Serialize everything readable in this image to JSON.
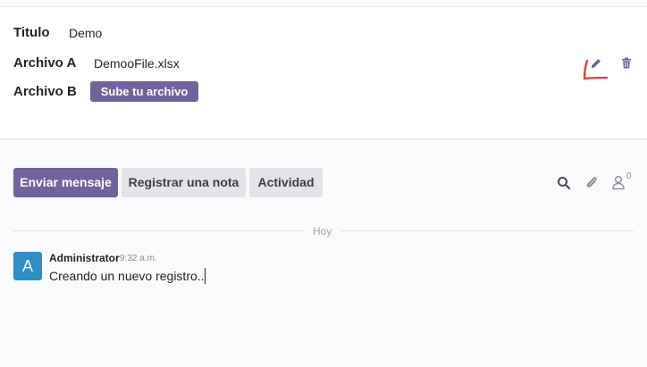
{
  "form": {
    "fields": [
      {
        "label": "Titulo",
        "value": "Demo"
      },
      {
        "label": "Archivo A",
        "value": "DemooFile.xlsx"
      },
      {
        "label": "Archivo B",
        "button_label": "Sube tu archivo"
      }
    ],
    "actions": {
      "edit_icon": "pencil-icon",
      "delete_icon": "trash-icon"
    }
  },
  "chatter": {
    "buttons": [
      "Enviar mensaje",
      "Registrar una nota",
      "Actividad"
    ],
    "toolbar_icons": [
      "search-icon",
      "paperclip-icon",
      "user-icon"
    ],
    "follower_count": "0",
    "day_separator": "Hoy",
    "messages": [
      {
        "avatar_letter": "A",
        "author": "Administrator",
        "time": "9:32 a.m.",
        "body": "Creando un nuevo registro.."
      }
    ]
  },
  "colors": {
    "primary": "#71639e",
    "secondary_button": "#e2e4e8",
    "avatar": "#2d8fc4",
    "annotation": "#e53935"
  }
}
